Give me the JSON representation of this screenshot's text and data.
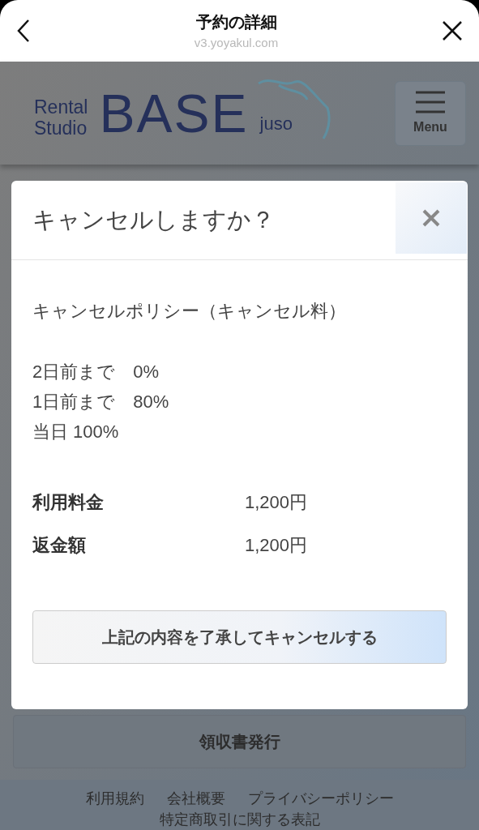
{
  "browser_bar": {
    "title": "予約の詳細",
    "url": "v3.yoyakul.com"
  },
  "site_header": {
    "logo": {
      "small_top": "Rental",
      "small_bottom": "Studio",
      "main": "BASE",
      "suffix": "juso"
    },
    "menu_label": "Menu"
  },
  "dialog": {
    "title": "キャンセルしますか？",
    "policy_heading": "キャンセルポリシー（キャンセル料）",
    "policy_lines": [
      "2日前まで　0%",
      "1日前まで　80%",
      "当日 100%"
    ],
    "fees": [
      {
        "label": "利用料金",
        "value": "1,200円"
      },
      {
        "label": "返金額",
        "value": "1,200円"
      }
    ],
    "confirm_button": "上記の内容を了承してキャンセルする"
  },
  "receipt_button": "領収書発行",
  "footer_links": [
    "利用規約",
    "会社概要",
    "プライバシーポリシー",
    "特定商取引に関する表記"
  ]
}
